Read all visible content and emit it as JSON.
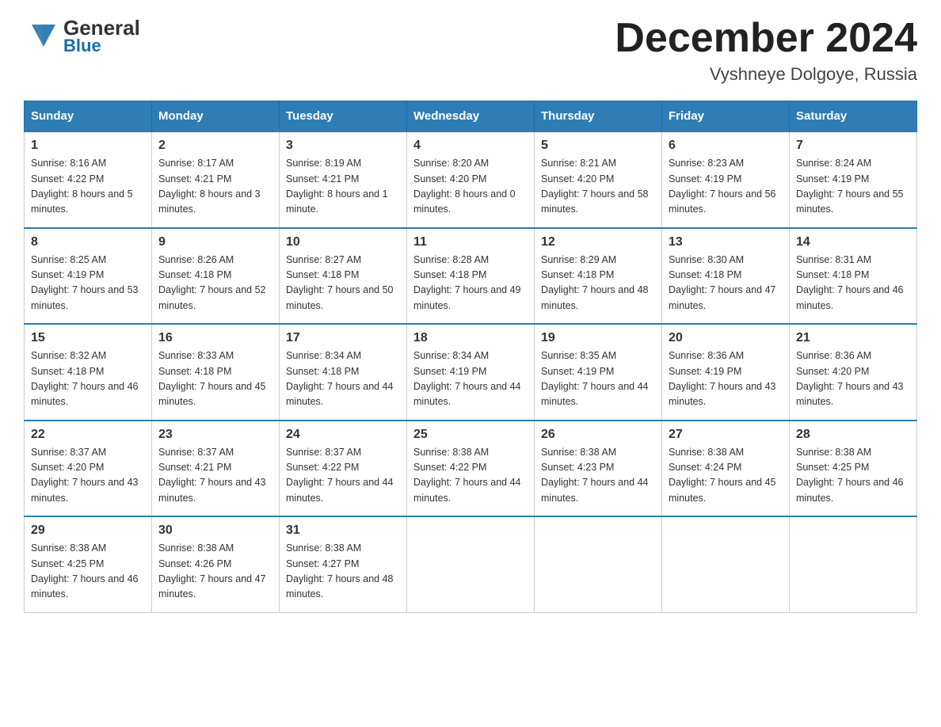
{
  "header": {
    "logo_general": "General",
    "logo_blue": "Blue",
    "title": "December 2024",
    "subtitle": "Vyshneye Dolgoye, Russia"
  },
  "weekdays": [
    "Sunday",
    "Monday",
    "Tuesday",
    "Wednesday",
    "Thursday",
    "Friday",
    "Saturday"
  ],
  "weeks": [
    [
      {
        "day": "1",
        "sunrise": "8:16 AM",
        "sunset": "4:22 PM",
        "daylight": "8 hours and 5 minutes."
      },
      {
        "day": "2",
        "sunrise": "8:17 AM",
        "sunset": "4:21 PM",
        "daylight": "8 hours and 3 minutes."
      },
      {
        "day": "3",
        "sunrise": "8:19 AM",
        "sunset": "4:21 PM",
        "daylight": "8 hours and 1 minute."
      },
      {
        "day": "4",
        "sunrise": "8:20 AM",
        "sunset": "4:20 PM",
        "daylight": "8 hours and 0 minutes."
      },
      {
        "day": "5",
        "sunrise": "8:21 AM",
        "sunset": "4:20 PM",
        "daylight": "7 hours and 58 minutes."
      },
      {
        "day": "6",
        "sunrise": "8:23 AM",
        "sunset": "4:19 PM",
        "daylight": "7 hours and 56 minutes."
      },
      {
        "day": "7",
        "sunrise": "8:24 AM",
        "sunset": "4:19 PM",
        "daylight": "7 hours and 55 minutes."
      }
    ],
    [
      {
        "day": "8",
        "sunrise": "8:25 AM",
        "sunset": "4:19 PM",
        "daylight": "7 hours and 53 minutes."
      },
      {
        "day": "9",
        "sunrise": "8:26 AM",
        "sunset": "4:18 PM",
        "daylight": "7 hours and 52 minutes."
      },
      {
        "day": "10",
        "sunrise": "8:27 AM",
        "sunset": "4:18 PM",
        "daylight": "7 hours and 50 minutes."
      },
      {
        "day": "11",
        "sunrise": "8:28 AM",
        "sunset": "4:18 PM",
        "daylight": "7 hours and 49 minutes."
      },
      {
        "day": "12",
        "sunrise": "8:29 AM",
        "sunset": "4:18 PM",
        "daylight": "7 hours and 48 minutes."
      },
      {
        "day": "13",
        "sunrise": "8:30 AM",
        "sunset": "4:18 PM",
        "daylight": "7 hours and 47 minutes."
      },
      {
        "day": "14",
        "sunrise": "8:31 AM",
        "sunset": "4:18 PM",
        "daylight": "7 hours and 46 minutes."
      }
    ],
    [
      {
        "day": "15",
        "sunrise": "8:32 AM",
        "sunset": "4:18 PM",
        "daylight": "7 hours and 46 minutes."
      },
      {
        "day": "16",
        "sunrise": "8:33 AM",
        "sunset": "4:18 PM",
        "daylight": "7 hours and 45 minutes."
      },
      {
        "day": "17",
        "sunrise": "8:34 AM",
        "sunset": "4:18 PM",
        "daylight": "7 hours and 44 minutes."
      },
      {
        "day": "18",
        "sunrise": "8:34 AM",
        "sunset": "4:19 PM",
        "daylight": "7 hours and 44 minutes."
      },
      {
        "day": "19",
        "sunrise": "8:35 AM",
        "sunset": "4:19 PM",
        "daylight": "7 hours and 44 minutes."
      },
      {
        "day": "20",
        "sunrise": "8:36 AM",
        "sunset": "4:19 PM",
        "daylight": "7 hours and 43 minutes."
      },
      {
        "day": "21",
        "sunrise": "8:36 AM",
        "sunset": "4:20 PM",
        "daylight": "7 hours and 43 minutes."
      }
    ],
    [
      {
        "day": "22",
        "sunrise": "8:37 AM",
        "sunset": "4:20 PM",
        "daylight": "7 hours and 43 minutes."
      },
      {
        "day": "23",
        "sunrise": "8:37 AM",
        "sunset": "4:21 PM",
        "daylight": "7 hours and 43 minutes."
      },
      {
        "day": "24",
        "sunrise": "8:37 AM",
        "sunset": "4:22 PM",
        "daylight": "7 hours and 44 minutes."
      },
      {
        "day": "25",
        "sunrise": "8:38 AM",
        "sunset": "4:22 PM",
        "daylight": "7 hours and 44 minutes."
      },
      {
        "day": "26",
        "sunrise": "8:38 AM",
        "sunset": "4:23 PM",
        "daylight": "7 hours and 44 minutes."
      },
      {
        "day": "27",
        "sunrise": "8:38 AM",
        "sunset": "4:24 PM",
        "daylight": "7 hours and 45 minutes."
      },
      {
        "day": "28",
        "sunrise": "8:38 AM",
        "sunset": "4:25 PM",
        "daylight": "7 hours and 46 minutes."
      }
    ],
    [
      {
        "day": "29",
        "sunrise": "8:38 AM",
        "sunset": "4:25 PM",
        "daylight": "7 hours and 46 minutes."
      },
      {
        "day": "30",
        "sunrise": "8:38 AM",
        "sunset": "4:26 PM",
        "daylight": "7 hours and 47 minutes."
      },
      {
        "day": "31",
        "sunrise": "8:38 AM",
        "sunset": "4:27 PM",
        "daylight": "7 hours and 48 minutes."
      },
      null,
      null,
      null,
      null
    ]
  ]
}
